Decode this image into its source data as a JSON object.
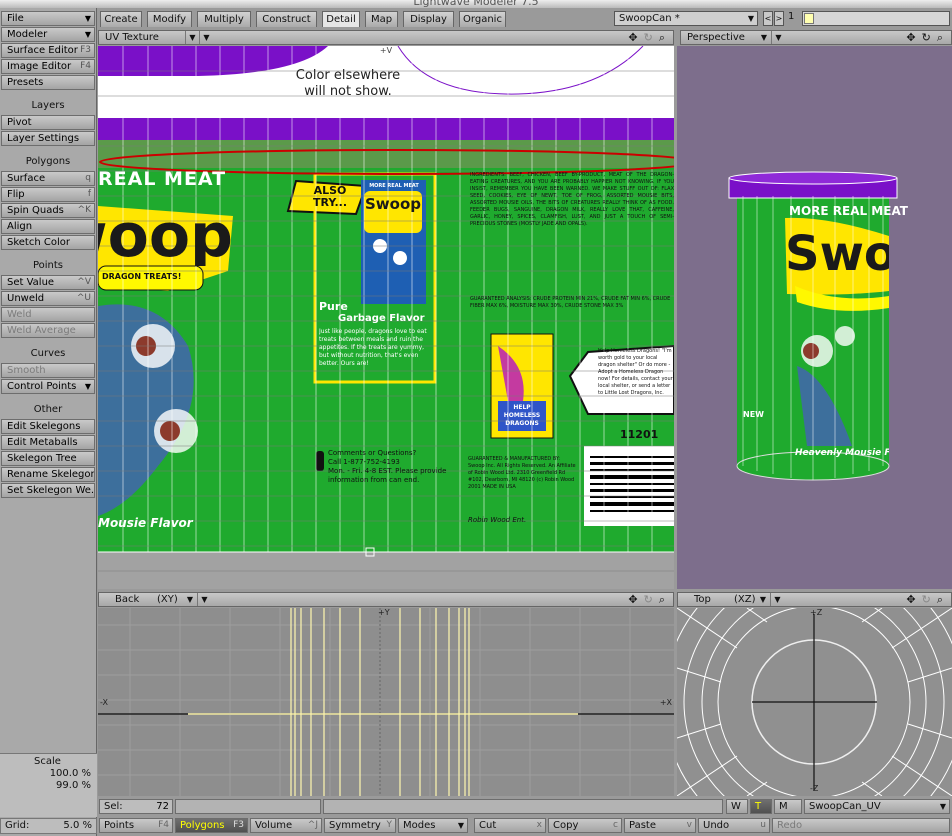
{
  "window": {
    "title": "Lightwave Modeler 7.5"
  },
  "left_panel": {
    "top_buttons": [
      {
        "label": "File"
      },
      {
        "label": "Modeler"
      },
      {
        "label": "Surface Editor",
        "shortcut": "F3"
      },
      {
        "label": "Image Editor",
        "shortcut": "F4"
      },
      {
        "label": "Presets"
      }
    ],
    "layers": {
      "title": "Layers",
      "items": [
        {
          "label": "Pivot"
        },
        {
          "label": "Layer Settings"
        }
      ]
    },
    "polygons": {
      "title": "Polygons",
      "items": [
        {
          "label": "Surface",
          "shortcut": "q"
        },
        {
          "label": "Flip",
          "shortcut": "f"
        },
        {
          "label": "Spin Quads",
          "shortcut": "^K"
        },
        {
          "label": "Align"
        },
        {
          "label": "Sketch Color"
        }
      ]
    },
    "points": {
      "title": "Points",
      "items": [
        {
          "label": "Set Value",
          "shortcut": "^V"
        },
        {
          "label": "Unweld",
          "shortcut": "^U"
        },
        {
          "label": "Weld"
        },
        {
          "label": "Weld Average"
        }
      ]
    },
    "curves": {
      "title": "Curves",
      "items": [
        {
          "label": "Smooth"
        },
        {
          "label": "Control Points"
        }
      ]
    },
    "other": {
      "title": "Other",
      "items": [
        {
          "label": "Edit Skelegons"
        },
        {
          "label": "Edit Metaballs"
        },
        {
          "label": "Skelegon Tree"
        },
        {
          "label": "Rename Skelegon"
        },
        {
          "label": "Set Skelegon We..."
        }
      ]
    },
    "scale": {
      "title": "Scale",
      "v1": "100.0 %",
      "v2": "99.0 %"
    },
    "grid": {
      "label": "Grid:",
      "value": "5.0 %"
    }
  },
  "tabs": [
    "Create",
    "Modify",
    "Multiply",
    "Construct",
    "Detail",
    "Map",
    "Display",
    "Organic"
  ],
  "active_tab": "Detail",
  "object": {
    "name": "SwoopCan *",
    "layer_number": "1"
  },
  "viewports": {
    "uv": {
      "mode": "UV Texture",
      "axis_top": "+V",
      "text1": "Color elsewhere",
      "text2": "will not show."
    },
    "persp": {
      "mode": "Perspective"
    },
    "back": {
      "mode": "Back",
      "axis": "(XY)",
      "y": "+Y",
      "x1": "-X",
      "x2": "+X"
    },
    "top": {
      "mode": "Top",
      "axis": "(XZ)",
      "z1": "+Z",
      "z2": "-Z"
    }
  },
  "label": {
    "real_meat": "REAL MEAT",
    "also_try": "ALSO TRY...",
    "more_real_meat": "MORE REAL MEAT",
    "brand": "Swoop",
    "tender": "DRAGON TREATS!",
    "pure": "Pure",
    "garbage": "Garbage Flavor",
    "desc": "Just like people, dragons love to eat treats between meals and ruin the appetites. If the treats are yummy, but without nutrition, that's even better. Ours are!",
    "comments": "Comments or Questions?",
    "call": "Call 1-877-752-4193",
    "hours": "Mon. - Fri. 4-8 EST. Please provide information from can end.",
    "ingredients": "INGREDIENTS: BEEF, CHICKEN, BEEF BY-PRODUCT, MEAT OF THE DRAGON-EATING CREATURES, AND YOU ARE PROBABLY HAPPIER NOT KNOWING. IF YOU INSIST, REMEMBER YOU HAVE BEEN WARNED. WE MAKE STUFF OUT OF: FLAX SEED, COOKIES, EYE OF NEWT, TOE OF FROG, ASSORTED MOUSIE BITS, ASSORTED MOUSIE OILS, THE BITS OF CREATURES REALLY THINK OF AS FOOD. FEEDER BUGS, SANGUINE, DRAGON MILK, REALLY LOVE THAT, CAFFEINE, GARLIC, HONEY, SPICES, CLAMFISH, LUST, AND JUST A TOUCH OF SEMI-PRECIOUS STONES (MOSTLY JADE AND OPALS).",
    "analysis": "GUARANTEED ANALYSIS: CRUDE PROTEIN MIN 21%, CRUDE FAT MIN 6%, CRUDE FIBER MAX 6%, MOISTURE MAX 30%, CRUDE STONE MAX 3%",
    "help": "HELP HOMELESS DRAGONS",
    "help_text": "Help Homeless Dragons! \"I'm worth gold to your local dragon shelter\" Or do more - Adopt a Homeless Dragon now! For details, contact your local shelter, or send a letter to Little Lost Dragons, Inc.",
    "number": "11201",
    "mfr": "GUARANTEED & MANUFACTURED BY: Swoop Inc. All Rights Reserved. An Affiliate of Robin Wood Ltd. 2310 Greenfield Rd #102, Dearborn, MI 48120 (c) Robin Wood 2001 MADE IN USA",
    "signature": "Robin Wood Ent.",
    "mousie": "Mousie Flavor",
    "heavenly": "Heavenly Mousie Flavor",
    "more_real": "MORE REAL MEAT",
    "new": "NEW"
  },
  "bottom": {
    "sel_label": "Sel:",
    "sel_count": "72",
    "modes": [
      {
        "label": "Points",
        "shortcut": "F4"
      },
      {
        "label": "Polygons",
        "shortcut": "F3"
      },
      {
        "label": "Volume",
        "shortcut": "^J"
      },
      {
        "label": "Symmetry",
        "shortcut": "Y"
      },
      {
        "label": "Modes"
      }
    ],
    "actions": [
      {
        "label": "Cut",
        "shortcut": "x"
      },
      {
        "label": "Copy",
        "shortcut": "c"
      },
      {
        "label": "Paste",
        "shortcut": "v"
      },
      {
        "label": "Undo",
        "shortcut": "u"
      },
      {
        "label": "Redo"
      }
    ],
    "wtm": [
      "W",
      "T",
      "M"
    ],
    "map": "SwoopCan_UV"
  },
  "colors": {
    "accent_red": "#cc0000",
    "purple": "#7a10c8",
    "green": "#1faa2e",
    "yellow": "#ffe600",
    "bg_purple": "#7d6e8c"
  }
}
